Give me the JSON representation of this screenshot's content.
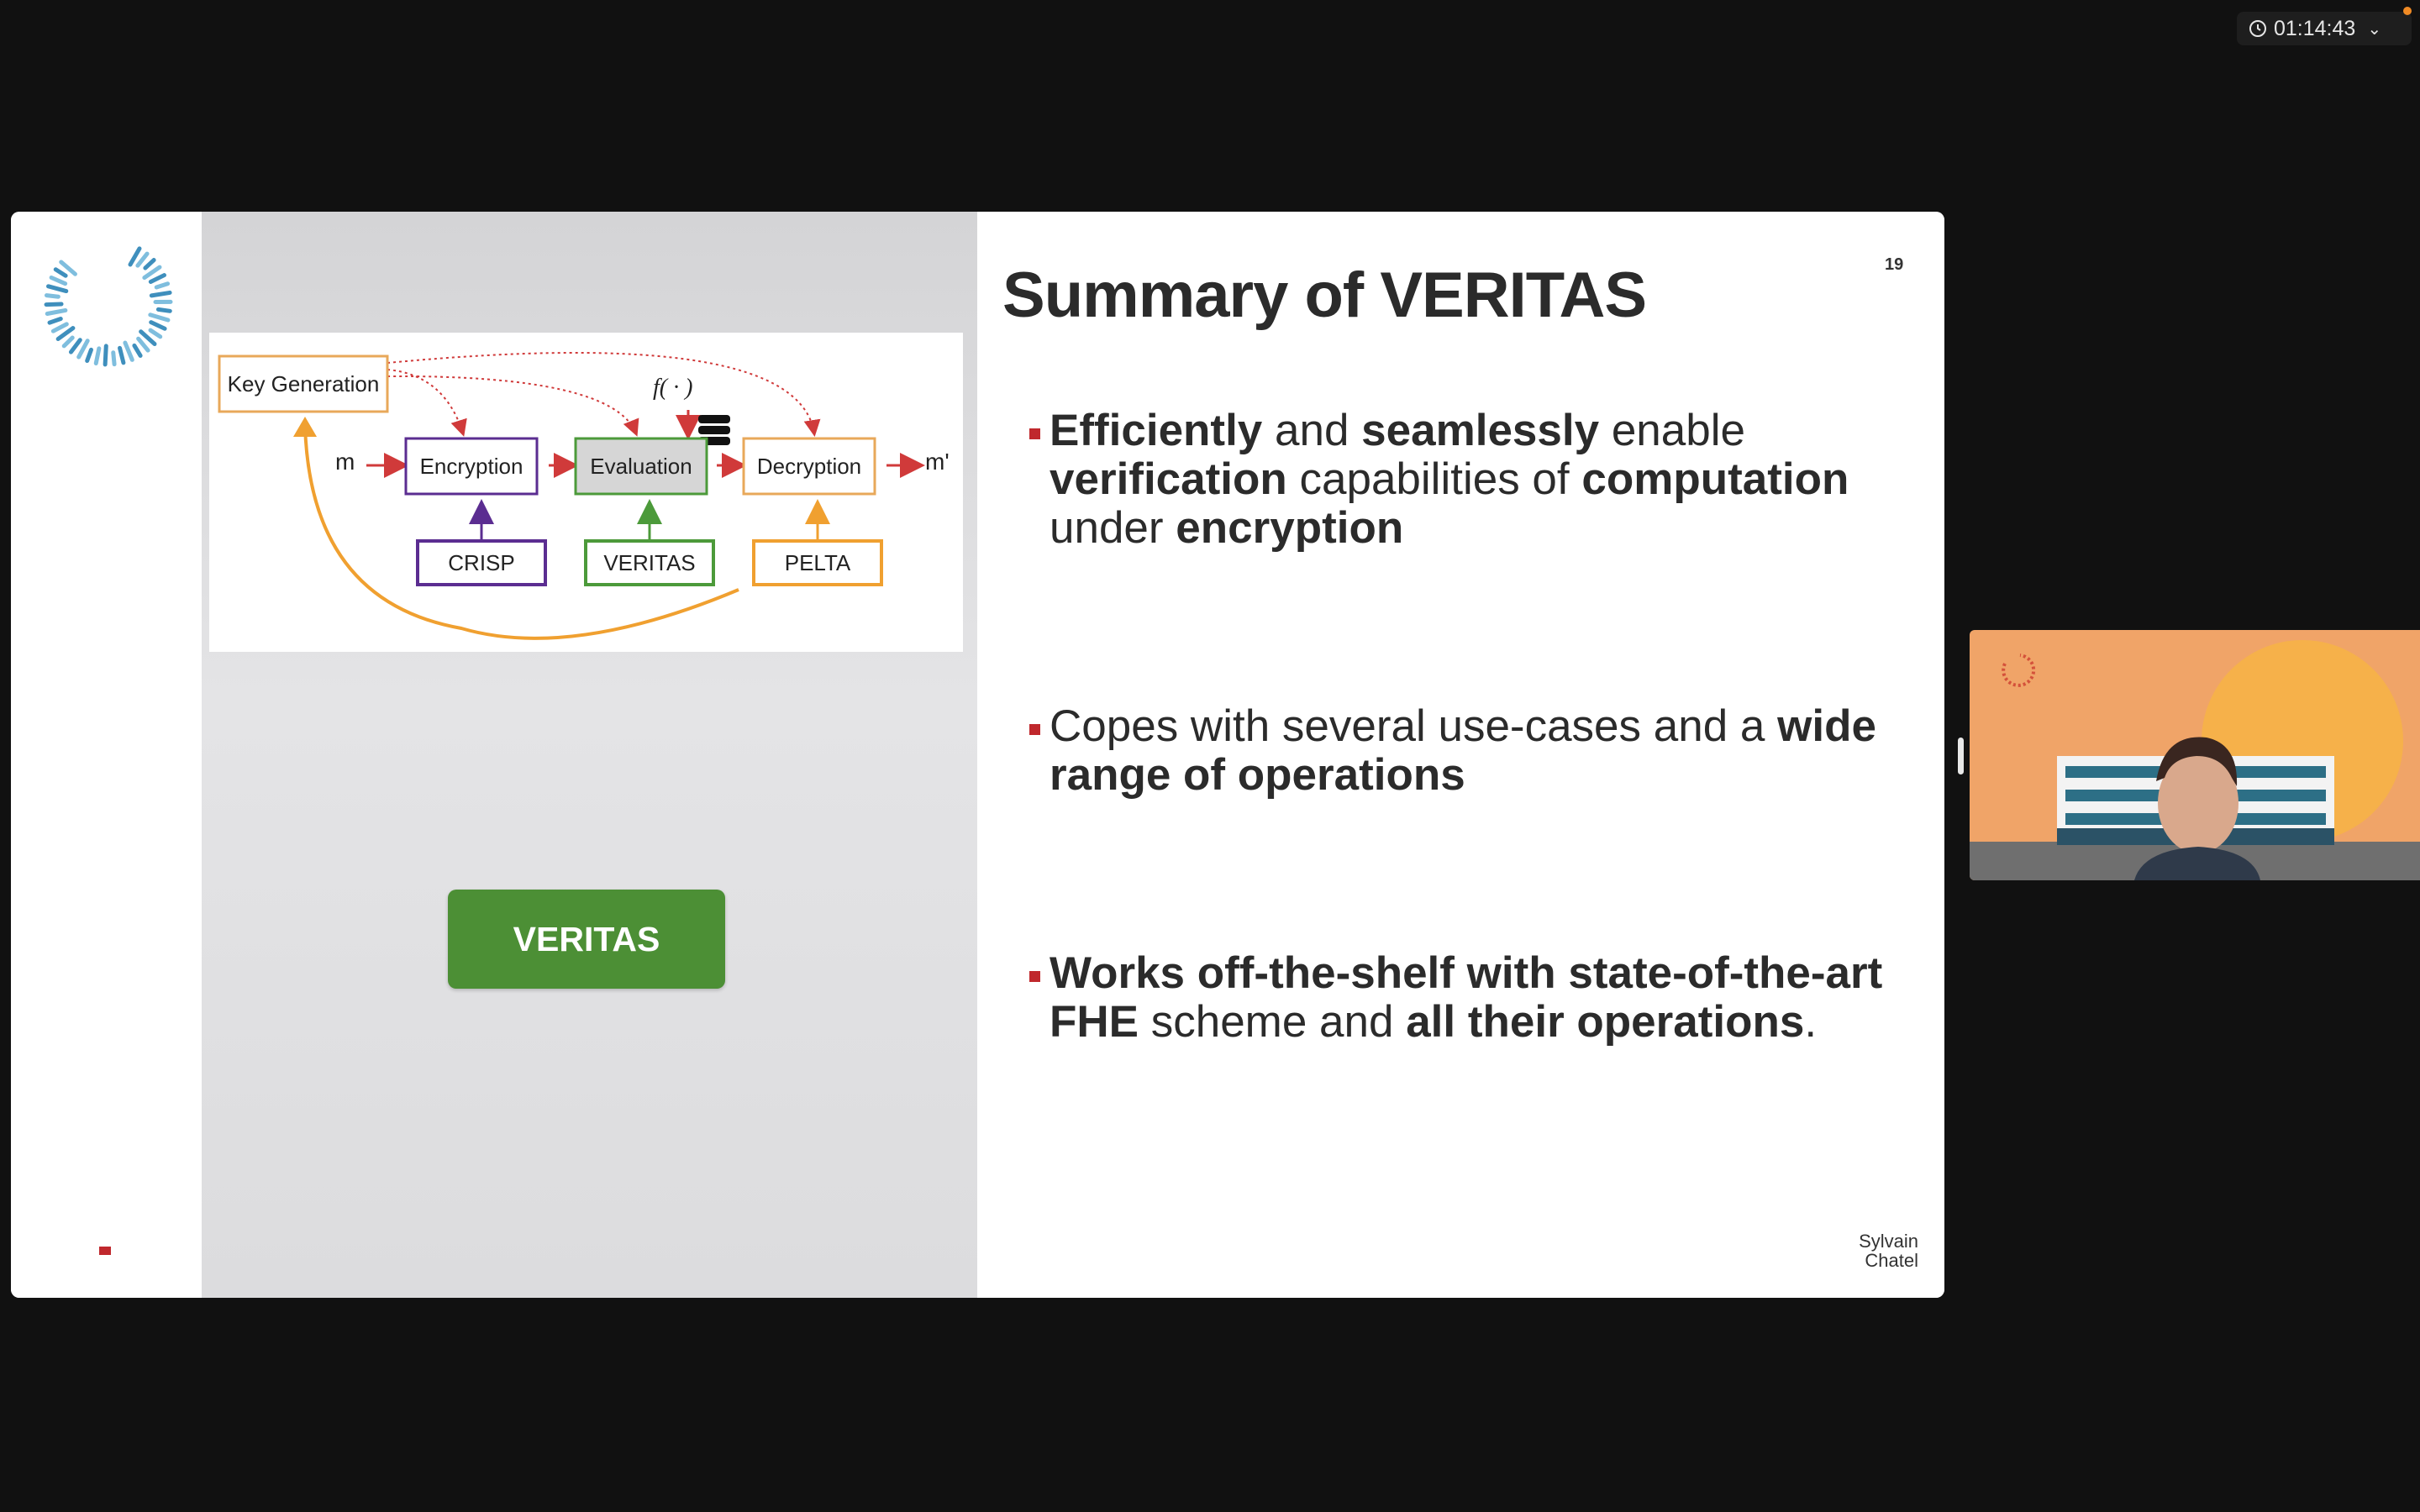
{
  "timer": {
    "time": "01:14:43",
    "icon": "clock-icon",
    "menu_icon": "chevron-down-icon"
  },
  "slide": {
    "title": "Summary of VERITAS",
    "page_number": "19",
    "author_line1": "Sylvain",
    "author_line2": "Chatel",
    "button_label": "VERITAS",
    "diagram": {
      "key_generation": "Key Generation",
      "input": "m",
      "encryption": "Encryption",
      "evaluation": "Evaluation",
      "decryption": "Decryption",
      "output": "m'",
      "function": "f( · )",
      "crisp": "CRISP",
      "veritas": "VERITAS",
      "pelta": "PELTA"
    },
    "bullets": [
      {
        "parts": [
          {
            "t": "Efficiently",
            "b": true
          },
          {
            "t": " and ",
            "b": false
          },
          {
            "t": "seamlessly",
            "b": true
          },
          {
            "t": " enable ",
            "b": false
          },
          {
            "t": "verification",
            "b": true
          },
          {
            "t": " capabilities of ",
            "b": false
          },
          {
            "t": "computation",
            "b": true
          },
          {
            "t": " under ",
            "b": false
          },
          {
            "t": "encryption",
            "b": true
          }
        ]
      },
      {
        "parts": [
          {
            "t": "Copes with several use-cases and a ",
            "b": false
          },
          {
            "t": "wide range of operations",
            "b": true
          }
        ]
      },
      {
        "parts": [
          {
            "t": " Works off-the-shelf with state-of-the-art FHE",
            "b": true
          },
          {
            "t": " scheme and ",
            "b": false
          },
          {
            "t": "all their operations",
            "b": true
          },
          {
            "t": ".",
            "b": false
          }
        ]
      }
    ]
  },
  "colors": {
    "accent_red": "#c0282d",
    "veritas_green": "#4c8f35",
    "crisp_purple": "#5b2d91",
    "pelta_orange": "#f0a030",
    "logo_blue": "#4a9cc8"
  }
}
